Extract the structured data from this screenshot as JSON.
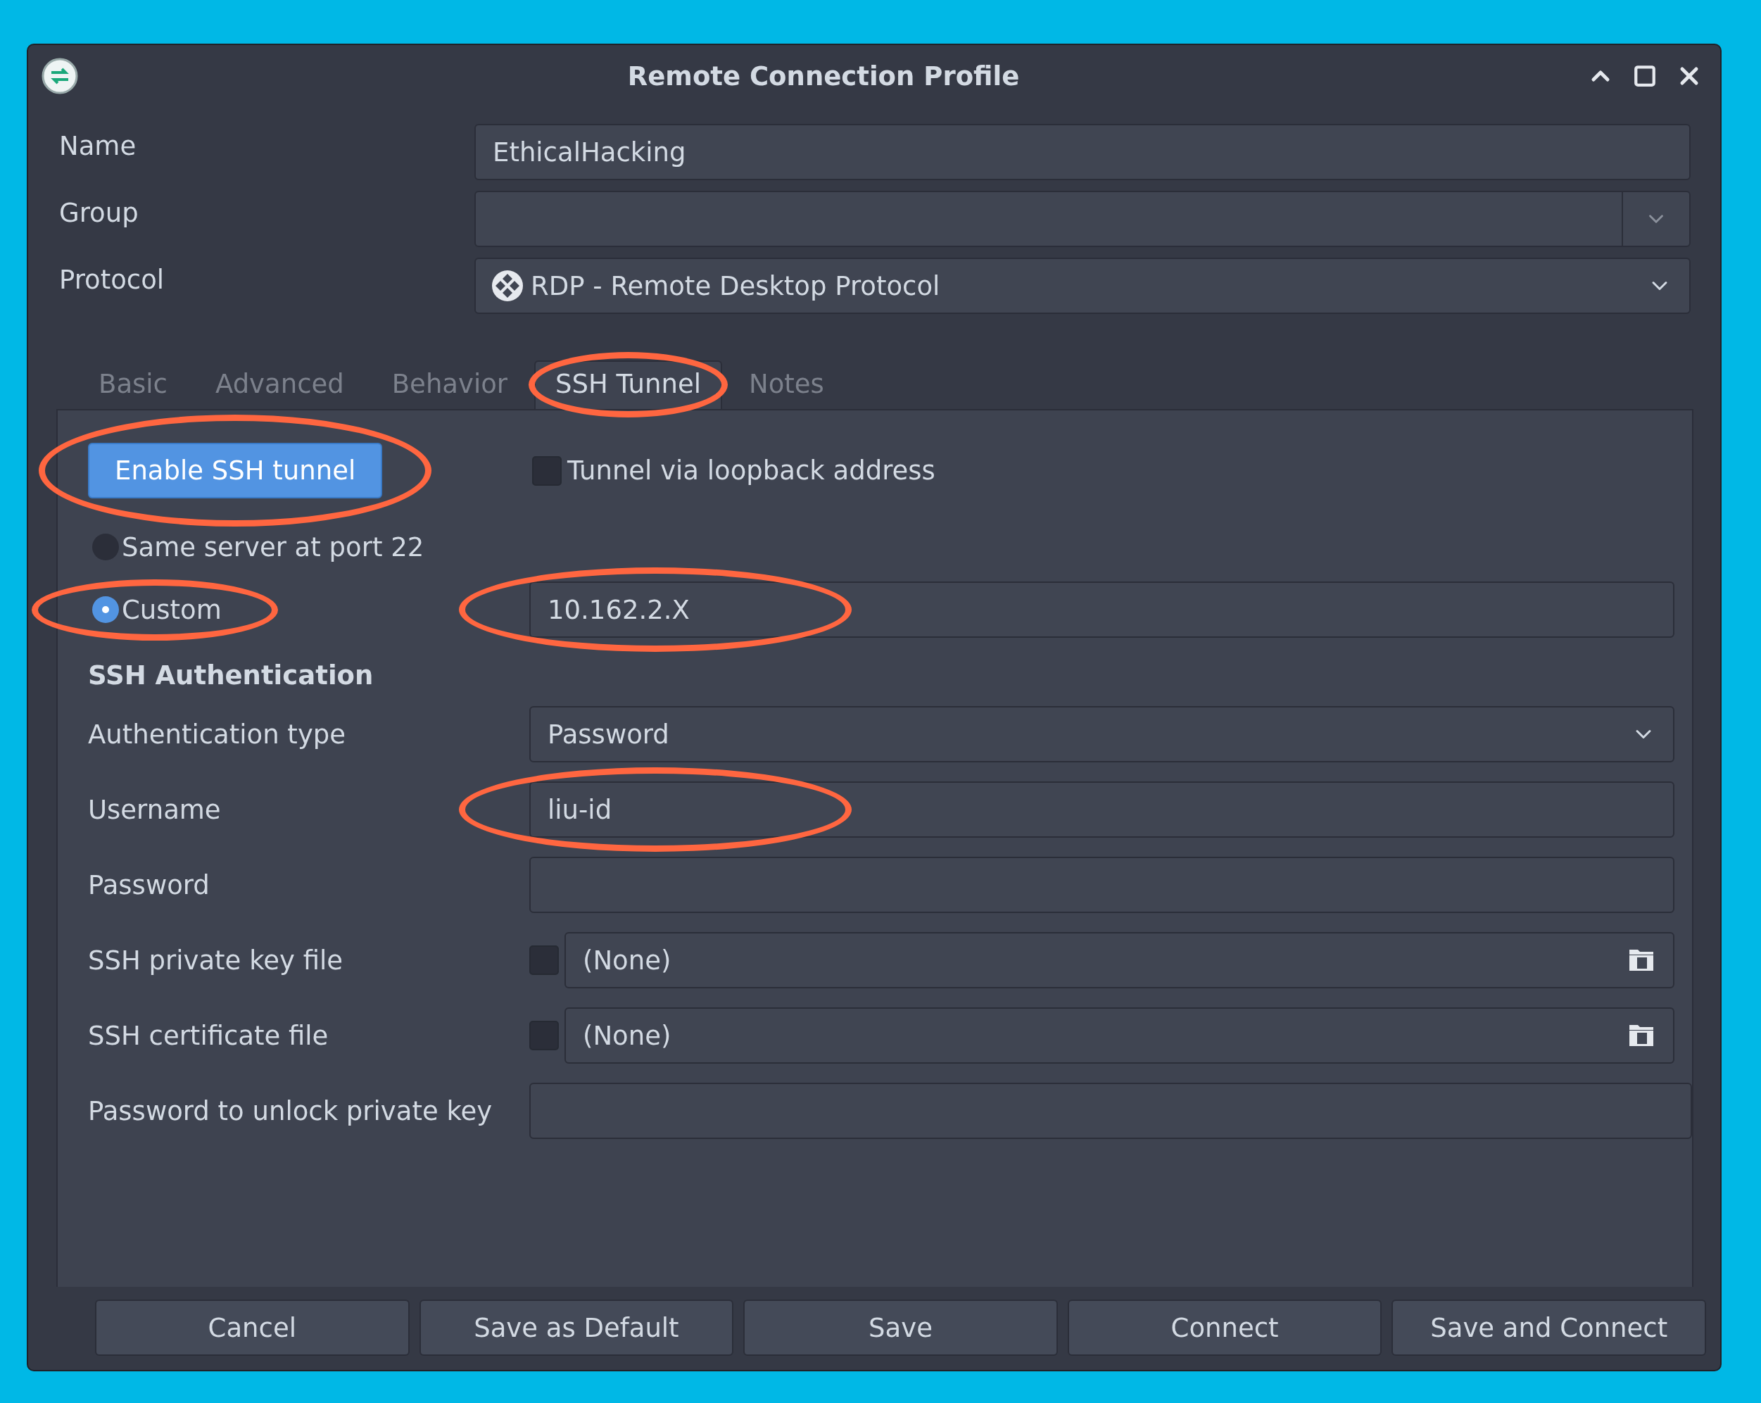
{
  "window": {
    "title": "Remote Connection Profile"
  },
  "profile_fields": [
    {
      "kind": "text",
      "label": "Name",
      "value": "EthicalHacking"
    },
    {
      "kind": "combo",
      "label": "Group"
    },
    {
      "kind": "select",
      "label": "Protocol",
      "value": "RDP - Remote Desktop Protocol"
    }
  ],
  "tabs": [
    {
      "label": "Basic",
      "selected": false,
      "highlighted": false
    },
    {
      "label": "Advanced",
      "selected": false,
      "highlighted": false
    },
    {
      "label": "Behavior",
      "selected": false,
      "highlighted": false
    },
    {
      "label": "SSH Tunnel",
      "selected": true,
      "highlighted": true
    },
    {
      "label": "Notes",
      "selected": false,
      "highlighted": false
    }
  ],
  "ssh_tunnel": {
    "enable_button": {
      "label": "Enable SSH tunnel",
      "highlighted": true
    },
    "loopback": {
      "label": "Tunnel via loopback address",
      "checked": false
    },
    "server_options": [
      {
        "label": "Same server at port 22",
        "selected": false,
        "highlighted": false
      },
      {
        "label": "Custom",
        "selected": true,
        "highlighted": true,
        "value": "10.162.2.X",
        "value_highlighted": true
      }
    ],
    "auth_heading": "SSH Authentication",
    "auth_fields": [
      {
        "kind": "select",
        "label": "Authentication type",
        "value": "Password"
      },
      {
        "kind": "text",
        "label": "Username",
        "value": "liu-id",
        "highlighted": true
      },
      {
        "kind": "password",
        "label": "Password"
      },
      {
        "kind": "file",
        "label": "SSH private key file",
        "checked": false,
        "value": "(None)"
      },
      {
        "kind": "file",
        "label": "SSH certificate file",
        "checked": false,
        "value": "(None)"
      },
      {
        "kind": "password",
        "label": "Password to unlock private key"
      }
    ]
  },
  "buttons": [
    "Cancel",
    "Save as Default",
    "Save",
    "Connect",
    "Save and Connect"
  ]
}
